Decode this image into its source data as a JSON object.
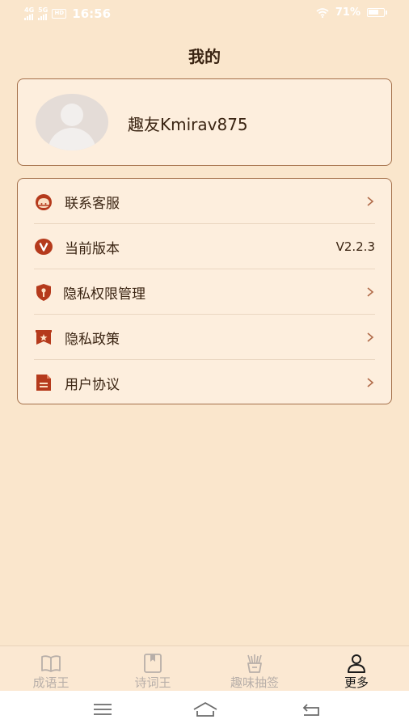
{
  "status_bar": {
    "net1": "4G",
    "net2": "5G",
    "msg_badge": "HD",
    "time": "16:56",
    "battery": "71%",
    "battery_level": 0.71
  },
  "page": {
    "title": "我的"
  },
  "profile": {
    "username": "趣友Kmirav875"
  },
  "menu": {
    "items": [
      {
        "label": "联系客服",
        "icon": "customer-service-icon",
        "value": ""
      },
      {
        "label": "当前版本",
        "icon": "version-v-icon",
        "value": "V2.2.3"
      },
      {
        "label": "隐私权限管理",
        "icon": "privacy-shield-icon",
        "value": ""
      },
      {
        "label": "隐私政策",
        "icon": "policy-star-icon",
        "value": ""
      },
      {
        "label": "用户协议",
        "icon": "agreement-document-icon",
        "value": ""
      }
    ]
  },
  "tabs": [
    {
      "label": "成语王",
      "icon": "book-icon",
      "active": false
    },
    {
      "label": "诗词王",
      "icon": "bookmark-book-icon",
      "active": false
    },
    {
      "label": "趣味抽签",
      "icon": "fortune-sticks-icon",
      "active": false
    },
    {
      "label": "更多",
      "icon": "person-icon",
      "active": true
    }
  ],
  "colors": {
    "background": "#fae6cc",
    "card": "#fdeedd",
    "card_border": "#a4704a",
    "icon_accent": "#b53a1c",
    "tab_inactive": "#b8afa9",
    "tab_active": "#1a1a1a"
  }
}
